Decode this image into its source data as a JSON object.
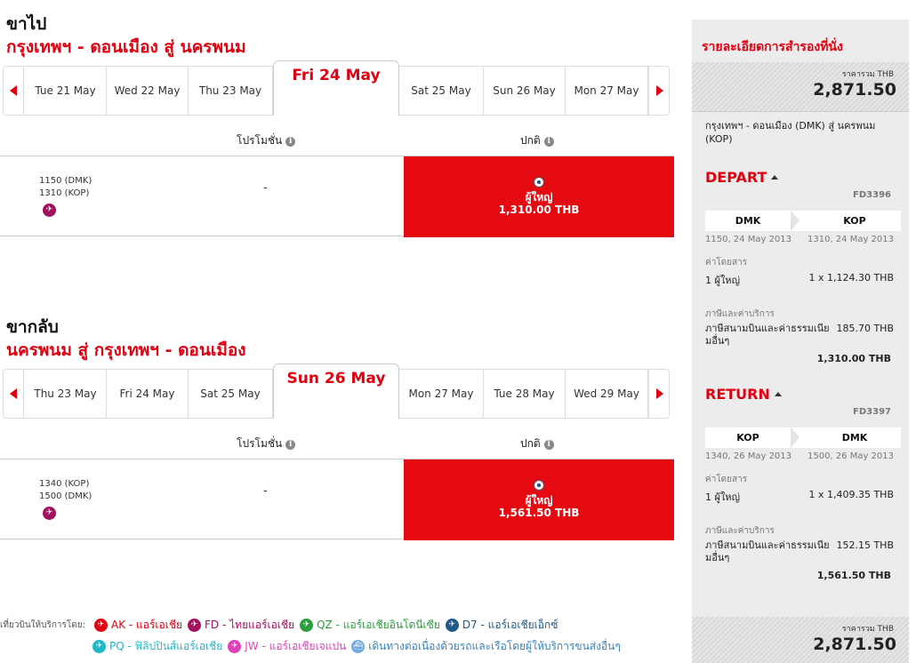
{
  "outbound": {
    "label": "ขาไป",
    "route": "กรุงเทพฯ - ดอนเมือง  สู่  นครพนม",
    "selected_date": "Fri 24 May",
    "dates_before": [
      "Tue 21 May",
      "Wed 22 May",
      "Thu 23 May"
    ],
    "dates_after": [
      "Sat 25 May",
      "Sun 26 May",
      "Mon 27 May"
    ],
    "col_promo": "โปรโมชั่น",
    "col_regular": "ปกติ",
    "depart_time": "1150  (DMK)",
    "arrive_time": "1310  (KOP)",
    "promo_value": "-",
    "fare_pax": "ผู้ใหญ่",
    "fare_price": "1,310.00 THB"
  },
  "inbound": {
    "label": "ขากลับ",
    "route": "นครพนม  สู่  กรุงเทพฯ - ดอนเมือง",
    "selected_date": "Sun 26 May",
    "dates_before": [
      "Thu 23 May",
      "Fri 24 May",
      "Sat 25 May"
    ],
    "dates_after": [
      "Mon 27 May",
      "Tue 28 May",
      "Wed 29 May"
    ],
    "col_promo": "โปรโมชั่น",
    "col_regular": "ปกติ",
    "depart_time": "1340  (KOP)",
    "arrive_time": "1500  (DMK)",
    "promo_value": "-",
    "fare_pax": "ผู้ใหญ่",
    "fare_price": "1,561.50 THB"
  },
  "footer": {
    "lead": "เที่ยวบินให้บริการโดย:",
    "airlines": [
      {
        "code": "AK",
        "text": "AK - แอร์เอเชีย",
        "color": "#e00010",
        "text_color": "#e00010"
      },
      {
        "code": "FD",
        "text": "FD - ไทยแอร์เอเชีย",
        "color": "#a2125c",
        "text_color": "#a2125c"
      },
      {
        "code": "QZ",
        "text": "QZ - แอร์เอเชียอินโดนีเซีย",
        "color": "#2a9d3c",
        "text_color": "#2a9d3c"
      },
      {
        "code": "D7",
        "text": "D7 - แอร์เอเชียเอ็กซ์",
        "color": "#1f5a8a",
        "text_color": "#1f5a8a"
      },
      {
        "code": "PQ",
        "text": "PQ - ฟิลิปปินส์แอร์เอเชีย",
        "color": "#20b8c8",
        "text_color": "#20b8c8"
      },
      {
        "code": "JW",
        "text": "JW - แอร์เอเชียเจแปน",
        "color": "#e040b8",
        "text_color": "#e040b8"
      },
      {
        "code": "bus",
        "text": "เดินทางต่อเนื่องด้วยรถและเรือโดยผู้ให้บริการขนส่งอื่นๆ",
        "color": "#6fa8dc",
        "text_color": "#3b82b8"
      }
    ]
  },
  "summary": {
    "title": "รายละเอียดการสำรองที่นั่ง",
    "total_label": "ราคารวม THB",
    "total_value": "2,871.50",
    "route_text": "กรุงเทพฯ - ดอนเมือง (DMK) สู่ นครพนม (KOP)",
    "depart": {
      "heading": "DEPART",
      "flight_no": "FD3396",
      "from": "DMK",
      "to": "KOP",
      "from_time": "1150, 24 May 2013",
      "to_time": "1310, 24 May 2013",
      "fare_label": "ค่าโดยสาร",
      "pax": "1 ผู้ใหญ่",
      "pax_fare": "1 x 1,124.30 THB",
      "tax_label": "ภาษีและค่าบริการ",
      "tax_desc": "ภาษีสนามบินและค่าธรรมเนียมอื่นๆ",
      "tax_value": "185.70 THB",
      "subtotal": "1,310.00 THB"
    },
    "return": {
      "heading": "RETURN",
      "flight_no": "FD3397",
      "from": "KOP",
      "to": "DMK",
      "from_time": "1340, 26 May 2013",
      "to_time": "1500, 26 May 2013",
      "fare_label": "ค่าโดยสาร",
      "pax": "1 ผู้ใหญ่",
      "pax_fare": "1 x 1,409.35 THB",
      "tax_label": "ภาษีและค่าบริการ",
      "tax_desc": "ภาษีสนามบินและค่าธรรมเนียมอื่นๆ",
      "tax_value": "152.15 THB",
      "subtotal": "1,561.50 THB"
    }
  },
  "colors": {
    "accent": "#e00010",
    "fare_bg": "#e50912",
    "panel_bg": "#ececec"
  }
}
